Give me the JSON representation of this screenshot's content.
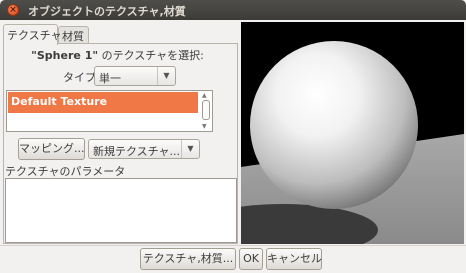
{
  "window": {
    "title": "オブジェクトのテクスチャ,材質",
    "close_symbol": "×"
  },
  "tabs": [
    {
      "label": "テクスチャ",
      "active": true
    },
    {
      "label": "材質",
      "active": false
    }
  ],
  "texture_panel": {
    "select_prefix": "\"Sphere 1\"",
    "select_suffix": " のテクスチャを選択:",
    "type_label": "タイプ",
    "type_value": "単一",
    "texture_list": [
      {
        "label": "Default Texture",
        "selected": true
      }
    ],
    "mapping_button": "マッピング...",
    "new_texture_combo": "新規テクスチャ...",
    "params_label": "テクスチャのパラメータ"
  },
  "footer": {
    "texture_material_button": "テクスチャ,材質...",
    "ok_button": "OK",
    "cancel_button": "キャンセル"
  },
  "icons": {
    "dropdown_arrow": "▼",
    "scroll_up": "▲",
    "scroll_down": "▼"
  },
  "colors": {
    "selection": "#f07746",
    "titlebar": "#3c3b37",
    "preview_background": "#000000"
  }
}
